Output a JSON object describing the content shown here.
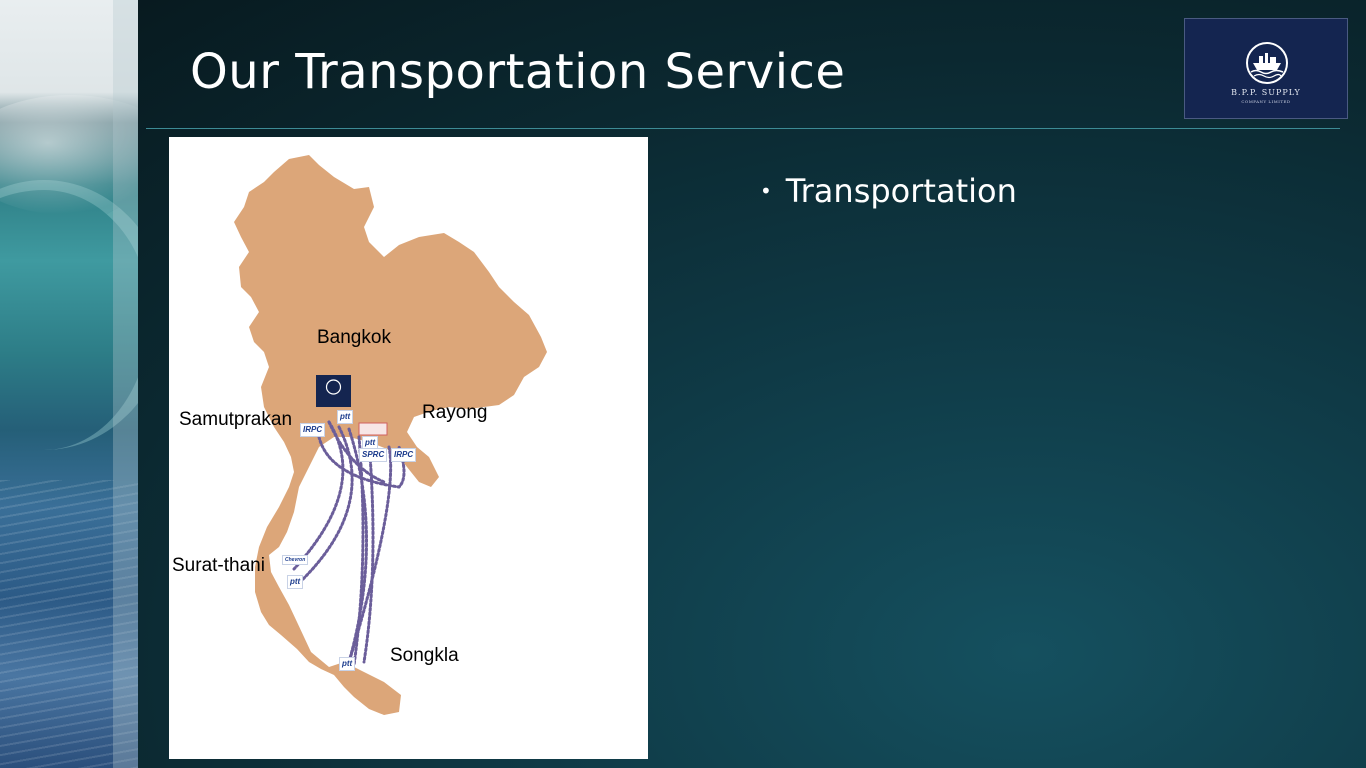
{
  "slide": {
    "title": "Our Transportation Service",
    "bullets": [
      "Transportation"
    ]
  },
  "logo": {
    "name": "B.P.P. SUPPLY",
    "subtitle": "COMPANY LIMITED"
  },
  "map": {
    "labels": {
      "bangkok": "Bangkok",
      "rayong": "Rayong",
      "samutprakan": "Samutprakan",
      "surat_thani": "Surat-thani",
      "songkla": "Songkla"
    },
    "partner_logos": {
      "ptt": "ptt",
      "irpc": "IRPC",
      "sprc": "SPRC",
      "chevron": "Chevron"
    }
  },
  "colors": {
    "map_land": "#dca679",
    "route_dots": "#6b5e9a",
    "title_text": "#ffffff",
    "divider": "#3d8b95",
    "logo_bg": "#142550"
  }
}
